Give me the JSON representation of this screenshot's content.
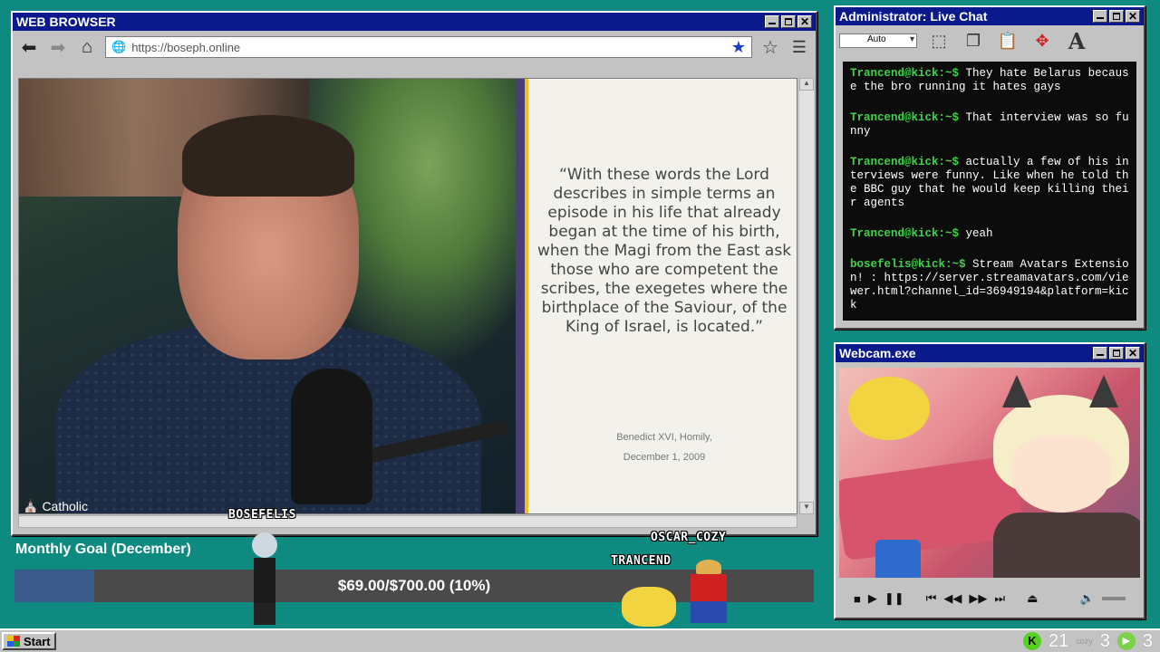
{
  "browser": {
    "title": "WEB BROWSER",
    "url": "https://boseph.online",
    "quote": "“With these words the Lord describes in simple terms an episode in his life that already began at the time of his birth, when the Magi from the East ask those who are competent the scribes, the exegetes where the birthplace of the Saviour, of the King of Israel, is located.”",
    "cite_line1": "Benedict XVI, Homily,",
    "cite_line2": "December 1, 2009",
    "channel_logo": "Catholic"
  },
  "chat": {
    "title": "Administrator: Live Chat",
    "font_select": "Auto",
    "messages": [
      {
        "user": "Trancend@kick:~$",
        "text": "They hate Belarus because the bro running it hates gays"
      },
      {
        "user": "Trancend@kick:~$",
        "text": "That interview was so funny"
      },
      {
        "user": "Trancend@kick:~$",
        "text": "actually a few of his interviews were funny. Like when he told the BBC guy that he would keep killing their agents"
      },
      {
        "user": "Trancend@kick:~$",
        "text": "yeah"
      },
      {
        "user": "bosefelis@kick:~$",
        "text": "Stream Avatars Extension! : https://server.streamavatars.com/viewer.html?channel_id=36949194&platform=kick"
      }
    ],
    "user_color": "#3fd34a"
  },
  "webcam": {
    "title": "Webcam.exe"
  },
  "overlay": {
    "avatar_names": [
      "BOSEFELIS",
      "OSCAR_COZY",
      "TRANCEND"
    ],
    "goal_title": "Monthly Goal (December)",
    "goal_text": "$69.00/$700.00 (10%)",
    "goal_progress": 0.1
  },
  "taskbar": {
    "start_label": "Start",
    "kick_viewers": "21",
    "cozy_label": "cozy",
    "cozy_viewers": "3",
    "other_viewers": "3"
  }
}
